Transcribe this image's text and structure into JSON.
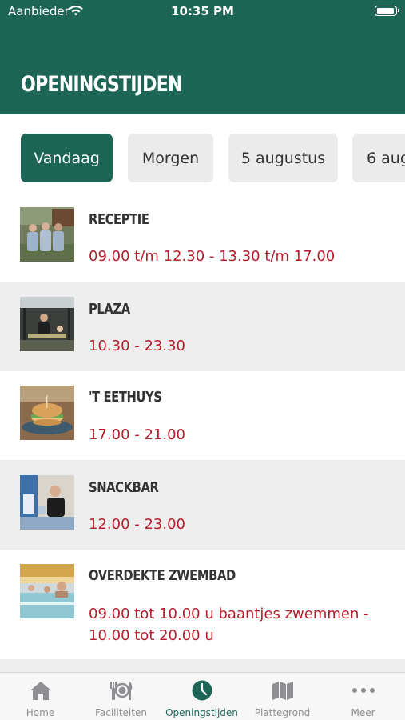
{
  "status_bar": {
    "carrier": "Aanbieder",
    "time": "10:35 PM"
  },
  "header": {
    "title": "OPENINGSTIJDEN"
  },
  "day_tabs": [
    {
      "label": "Vandaag",
      "selected": true
    },
    {
      "label": "Morgen",
      "selected": false
    },
    {
      "label": "5 augustus",
      "selected": false
    },
    {
      "label": "6 aug",
      "selected": false
    }
  ],
  "facilities": [
    {
      "name": "RECEPTIE",
      "hours": "09.00 t/m 12.30 - 13.30 t/m 17.00"
    },
    {
      "name": "PLAZA",
      "hours": "10.30 - 23.30"
    },
    {
      "name": "'T EETHUYS",
      "hours": "17.00 - 21.00"
    },
    {
      "name": "SNACKBAR",
      "hours": "12.00 - 23.00"
    },
    {
      "name": "OVERDEKTE ZWEMBAD",
      "hours": "09.00 tot 10.00 u baantjes zwemmen - 10.00 tot 20.00 u"
    }
  ],
  "tab_bar": [
    {
      "label": "Home",
      "icon": "home-icon",
      "active": false
    },
    {
      "label": "Faciliteiten",
      "icon": "cutlery-icon",
      "active": false
    },
    {
      "label": "Openingstijden",
      "icon": "clock-icon",
      "active": true
    },
    {
      "label": "Plattegrond",
      "icon": "map-icon",
      "active": false
    },
    {
      "label": "Meer",
      "icon": "more-icon",
      "active": false
    }
  ],
  "colors": {
    "brand": "#1d6656",
    "hours_text": "#b71c2b",
    "row_alt": "#eeeeee"
  }
}
